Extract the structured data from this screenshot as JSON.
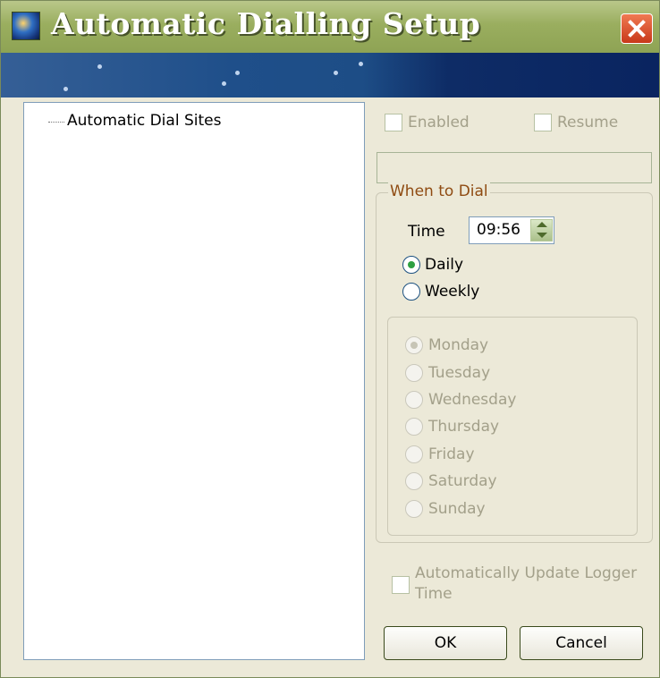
{
  "window": {
    "title": "Automatic Dialling Setup"
  },
  "tree": {
    "root_label": "Automatic Dial Sites"
  },
  "options": {
    "enabled_label": "Enabled",
    "resume_label": "Resume",
    "site_field_value": ""
  },
  "when_to_dial": {
    "title": "When to Dial",
    "time_label": "Time",
    "time_value": "09:56",
    "daily_label": "Daily",
    "weekly_label": "Weekly",
    "selected_frequency": "Daily",
    "days": [
      "Monday",
      "Tuesday",
      "Wednesday",
      "Thursday",
      "Friday",
      "Saturday",
      "Sunday"
    ],
    "selected_day": "Monday"
  },
  "auto_update": {
    "label_line1": "Automatically Update Logger",
    "label_line2": "Time"
  },
  "buttons": {
    "ok": "OK",
    "cancel": "Cancel"
  },
  "colors": {
    "title_bar": "#9aae5f",
    "group_title": "#8f4b12",
    "disabled_text": "#a3a08a"
  }
}
